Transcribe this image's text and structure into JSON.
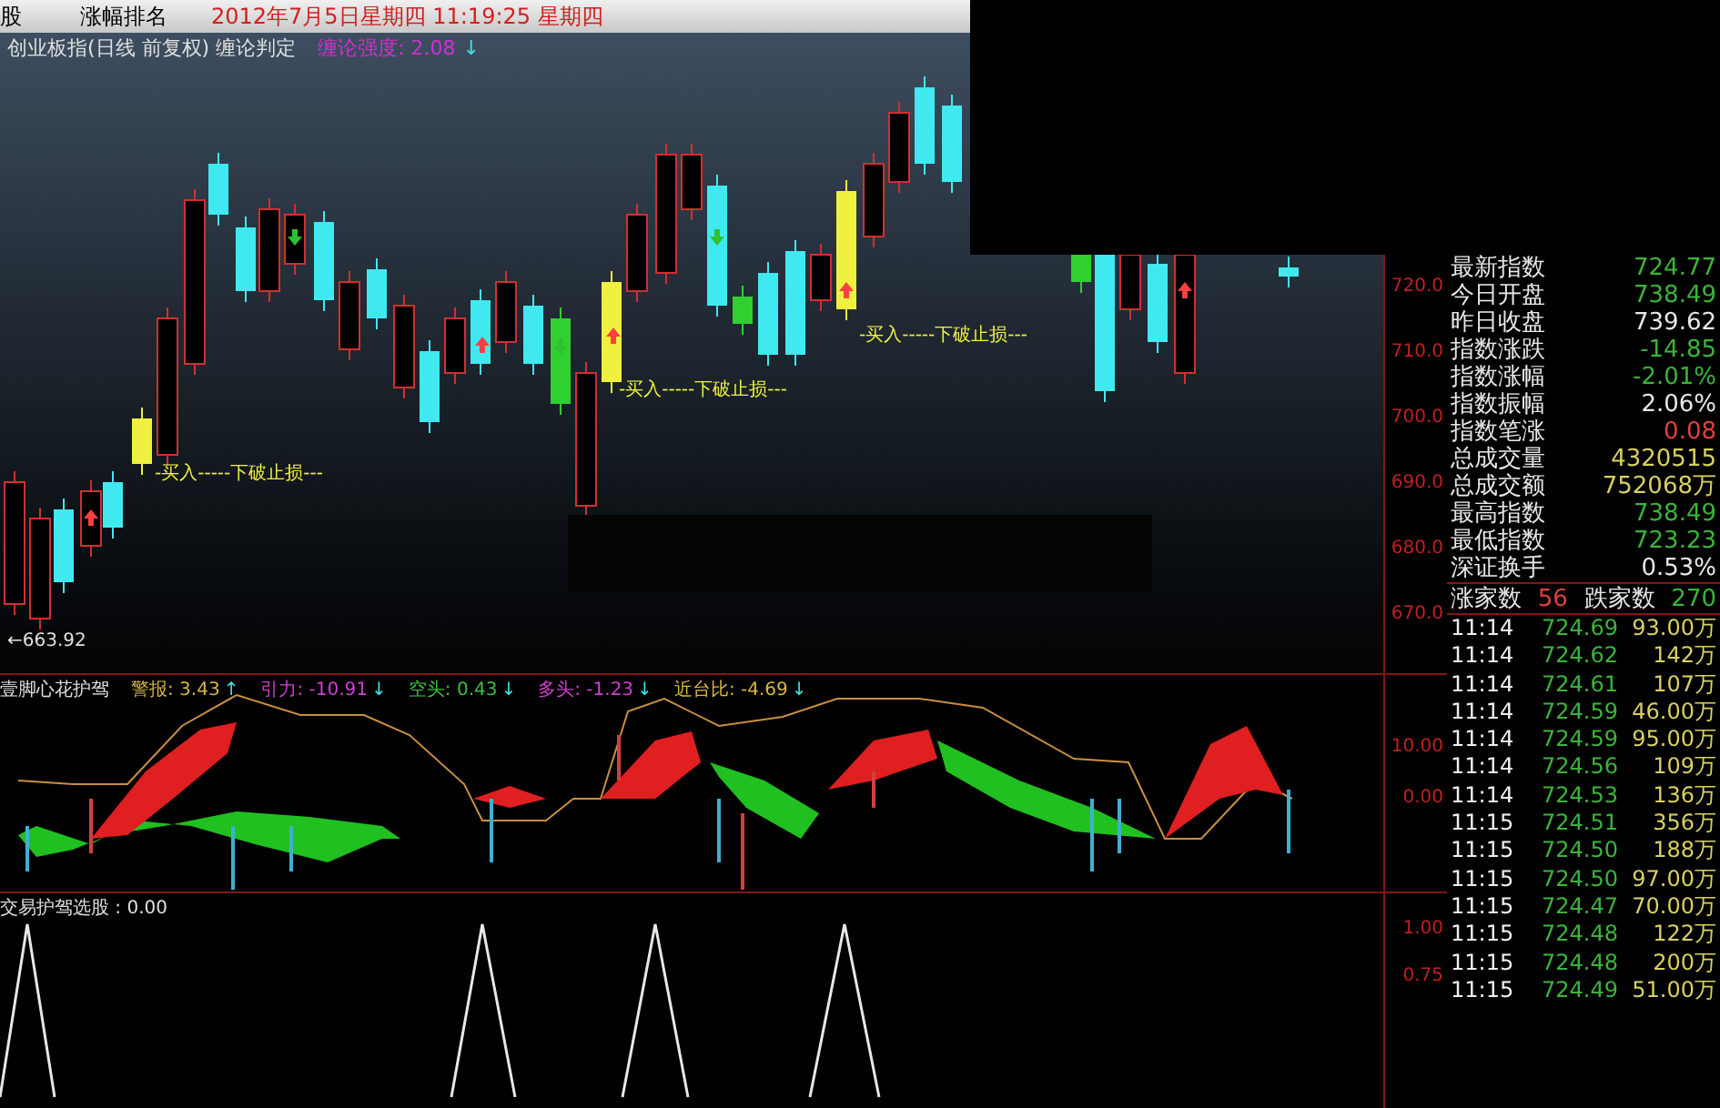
{
  "top_bar": {
    "tabs": [
      {
        "label": "股"
      },
      {
        "label": "涨幅排名"
      }
    ],
    "datetime": "2012年7月5日星期四  11:19:25 星期四"
  },
  "main_chart": {
    "title": "创业板指(日线 前复权) 缠论判定",
    "indicator": {
      "label": "缠论强度: 2.08",
      "arrow": "↓"
    },
    "annotations": [
      "-买入-----下破止损---",
      "-买入-----下破止损---",
      "-买入-----下破止损---"
    ],
    "low_marker": "←663.92",
    "y_axis": [
      "720.0",
      "710.0",
      "700.0",
      "690.0",
      "680.0",
      "670.0"
    ]
  },
  "oscillator": {
    "title": "壹脚心花护驾",
    "readings": [
      {
        "label": "警报: 3.43",
        "arrow": "↑",
        "color": "#d8b840"
      },
      {
        "label": "引力: -10.91",
        "arrow": "↓",
        "color": "#d040d0"
      },
      {
        "label": "空头: 0.43",
        "arrow": "↓",
        "color": "#40c040"
      },
      {
        "label": "多头: -1.23",
        "arrow": "↓",
        "color": "#d040d0"
      },
      {
        "label": "近台比: -4.69",
        "arrow": "↓",
        "color": "#d8b840"
      }
    ],
    "y_axis": [
      "10.00",
      "0.00"
    ]
  },
  "signal_panel": {
    "title": "交易护驾选股 : 0.00",
    "y_axis": [
      "1.00",
      "0.75"
    ]
  },
  "quote_panel": {
    "stats": [
      {
        "label": "最新指数",
        "value": "724.77",
        "color": "#3cb43c"
      },
      {
        "label": "今日开盘",
        "value": "738.49",
        "color": "#3cb43c"
      },
      {
        "label": "昨日收盘",
        "value": "739.62",
        "color": "#e8e8e8"
      },
      {
        "label": "指数涨跌",
        "value": "-14.85",
        "color": "#3cb43c"
      },
      {
        "label": "指数涨幅",
        "value": "-2.01%",
        "color": "#3cb43c"
      },
      {
        "label": "指数振幅",
        "value": "2.06%",
        "color": "#e8e8e8"
      },
      {
        "label": "指数笔涨",
        "value": "0.08",
        "color": "#e04040"
      },
      {
        "label": "总成交量",
        "value": "4320515",
        "color": "#d8d060"
      },
      {
        "label": "总成交额",
        "value": "752068万",
        "color": "#d8d060"
      },
      {
        "label": "最高指数",
        "value": "738.49",
        "color": "#3cb43c"
      },
      {
        "label": "最低指数",
        "value": "723.23",
        "color": "#3cb43c"
      },
      {
        "label": "深证换手",
        "value": "0.53%",
        "color": "#e8e8e8"
      }
    ],
    "breadth": {
      "up_label": "涨家数",
      "up_count": "56",
      "down_label": "跌家数",
      "down_count": "270"
    },
    "trades": [
      {
        "time": "11:14",
        "price": "724.69",
        "volume": "93.00万"
      },
      {
        "time": "11:14",
        "price": "724.62",
        "volume": "142万"
      },
      {
        "time": "11:14",
        "price": "724.61",
        "volume": "107万"
      },
      {
        "time": "11:14",
        "price": "724.59",
        "volume": "46.00万"
      },
      {
        "time": "11:14",
        "price": "724.59",
        "volume": "95.00万"
      },
      {
        "time": "11:14",
        "price": "724.56",
        "volume": "109万"
      },
      {
        "time": "11:14",
        "price": "724.53",
        "volume": "136万"
      },
      {
        "time": "11:15",
        "price": "724.51",
        "volume": "356万"
      },
      {
        "time": "11:15",
        "price": "724.50",
        "volume": "188万"
      },
      {
        "time": "11:15",
        "price": "724.50",
        "volume": "97.00万"
      },
      {
        "time": "11:15",
        "price": "724.47",
        "volume": "70.00万"
      },
      {
        "time": "11:15",
        "price": "724.48",
        "volume": "122万"
      },
      {
        "time": "11:15",
        "price": "724.48",
        "volume": "200万"
      },
      {
        "time": "11:15",
        "price": "724.49",
        "volume": "51.00万"
      }
    ]
  }
}
